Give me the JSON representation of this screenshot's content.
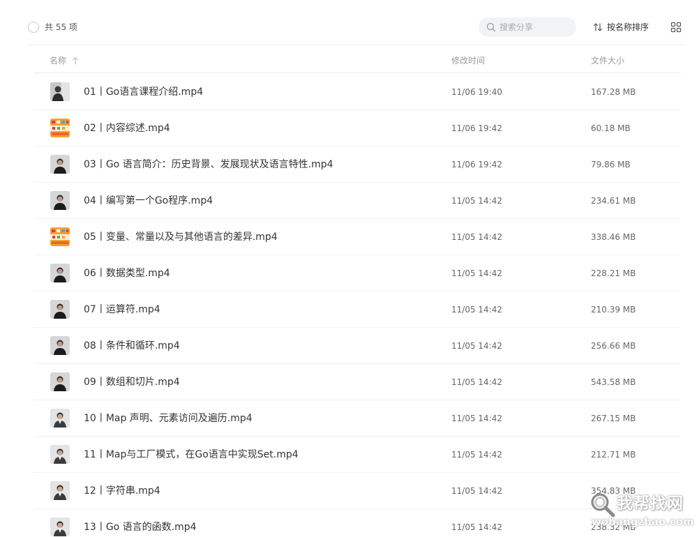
{
  "toolbar": {
    "count_text": "共 55 项",
    "search_placeholder": "搜索分享",
    "search_value": "",
    "sort_label": "按名称排序"
  },
  "columns": {
    "name": "名称",
    "mtime": "修改时间",
    "size": "文件大小"
  },
  "colors": {
    "text": "#333333",
    "muted": "#999999",
    "divider": "#eeeeee",
    "search_bg": "#f2f3f5"
  },
  "files": [
    {
      "name": "01丨Go语言课程介绍.mp4",
      "mtime": "11/06 19:40",
      "size": "167.28 MB",
      "thumb": "person-gray"
    },
    {
      "name": "02丨内容综述.mp4",
      "mtime": "11/06 19:42",
      "size": "60.18 MB",
      "thumb": "colorful-slide"
    },
    {
      "name": "03丨Go 语言简介：历史背景、发展现状及语言特性.mp4",
      "mtime": "11/06 19:42",
      "size": "79.86 MB",
      "thumb": "person-dark"
    },
    {
      "name": "04丨编写第一个Go程序.mp4",
      "mtime": "11/05 14:42",
      "size": "234.61 MB",
      "thumb": "person-dark"
    },
    {
      "name": "05丨变量、常量以及与其他语言的差异.mp4",
      "mtime": "11/05 14:42",
      "size": "338.46 MB",
      "thumb": "colorful-slide"
    },
    {
      "name": "06丨数据类型.mp4",
      "mtime": "11/05 14:42",
      "size": "228.21 MB",
      "thumb": "person-dark"
    },
    {
      "name": "07丨运算符.mp4",
      "mtime": "11/05 14:42",
      "size": "210.39 MB",
      "thumb": "person-dark"
    },
    {
      "name": "08丨条件和循环.mp4",
      "mtime": "11/05 14:42",
      "size": "256.66 MB",
      "thumb": "person-dark"
    },
    {
      "name": "09丨数组和切片.mp4",
      "mtime": "11/05 14:42",
      "size": "543.58 MB",
      "thumb": "person-dark"
    },
    {
      "name": "10丨Map 声明、元素访问及遍历.mp4",
      "mtime": "11/05 14:42",
      "size": "267.15 MB",
      "thumb": "person-light"
    },
    {
      "name": "11丨Map与工厂模式，在Go语言中实现Set.mp4",
      "mtime": "11/05 14:42",
      "size": "212.71 MB",
      "thumb": "person-light"
    },
    {
      "name": "12丨字符串.mp4",
      "mtime": "11/05 14:42",
      "size": "354.83 MB",
      "thumb": "person-light"
    },
    {
      "name": "13丨Go 语言的函数.mp4",
      "mtime": "11/05 14:42",
      "size": "238.32 MB",
      "thumb": "person-light"
    }
  ],
  "watermark": {
    "title": "我帮找网",
    "url": "wobangzhao.com"
  }
}
